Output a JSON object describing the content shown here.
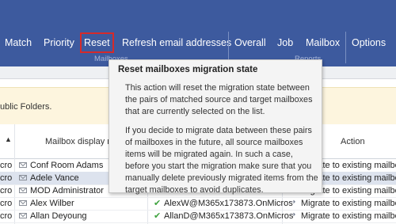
{
  "ribbon": {
    "items": [
      {
        "label": "Match"
      },
      {
        "label": "Priority"
      },
      {
        "label": "Reset"
      },
      {
        "label": "Refresh email addresses"
      },
      {
        "label": "Overall"
      },
      {
        "label": "Job"
      },
      {
        "label": "Mailbox"
      },
      {
        "label": "Options"
      }
    ],
    "groups": {
      "mailboxes": "Mailboxes",
      "reports": "Reports"
    }
  },
  "info_text": "ublic Folders.",
  "table": {
    "headers": {
      "display_name": "Mailbox display na",
      "action": "Action"
    },
    "rows": [
      {
        "prefix": "cro",
        "name": "Conf Room Adams",
        "target": "",
        "action": "Migrate to existing mailbo",
        "selected": false
      },
      {
        "prefix": "cro",
        "name": "Adele Vance",
        "target": "",
        "action": "Migrate to existing mailbo",
        "selected": true
      },
      {
        "prefix": "cro",
        "name": "MOD Administrator",
        "target": "",
        "action": "Migrate to existing mailbo",
        "selected": false
      },
      {
        "prefix": "cro",
        "name": "Alex Wilber",
        "target": "AlexW@M365x173873.OnMicros",
        "action": "Migrate to existing mailbo",
        "selected": false
      },
      {
        "prefix": "cro",
        "name": "Allan Deyoung",
        "target": "AllanD@M365x173873.OnMicros",
        "action": "Migrate to existing mailbo",
        "selected": false
      }
    ]
  },
  "tooltip": {
    "title": "Reset mailboxes migration state",
    "paragraph1": "This action will reset the migration state between the pairs of matched source and target mailboxes that are currently selected on the list.",
    "paragraph2": "If you decide to migrate data between these pairs of mailboxes in the future, all source mailboxes items will be migrated again. In such a case, before you start the migration make sure that you manually delete previously migrated items from the target mailboxes to avoid duplicates."
  },
  "colors": {
    "ribbon": "#3d5a9e",
    "highlight": "#d62a2a",
    "info_bar": "#fdf5de",
    "selected_row": "#dde3ee"
  }
}
